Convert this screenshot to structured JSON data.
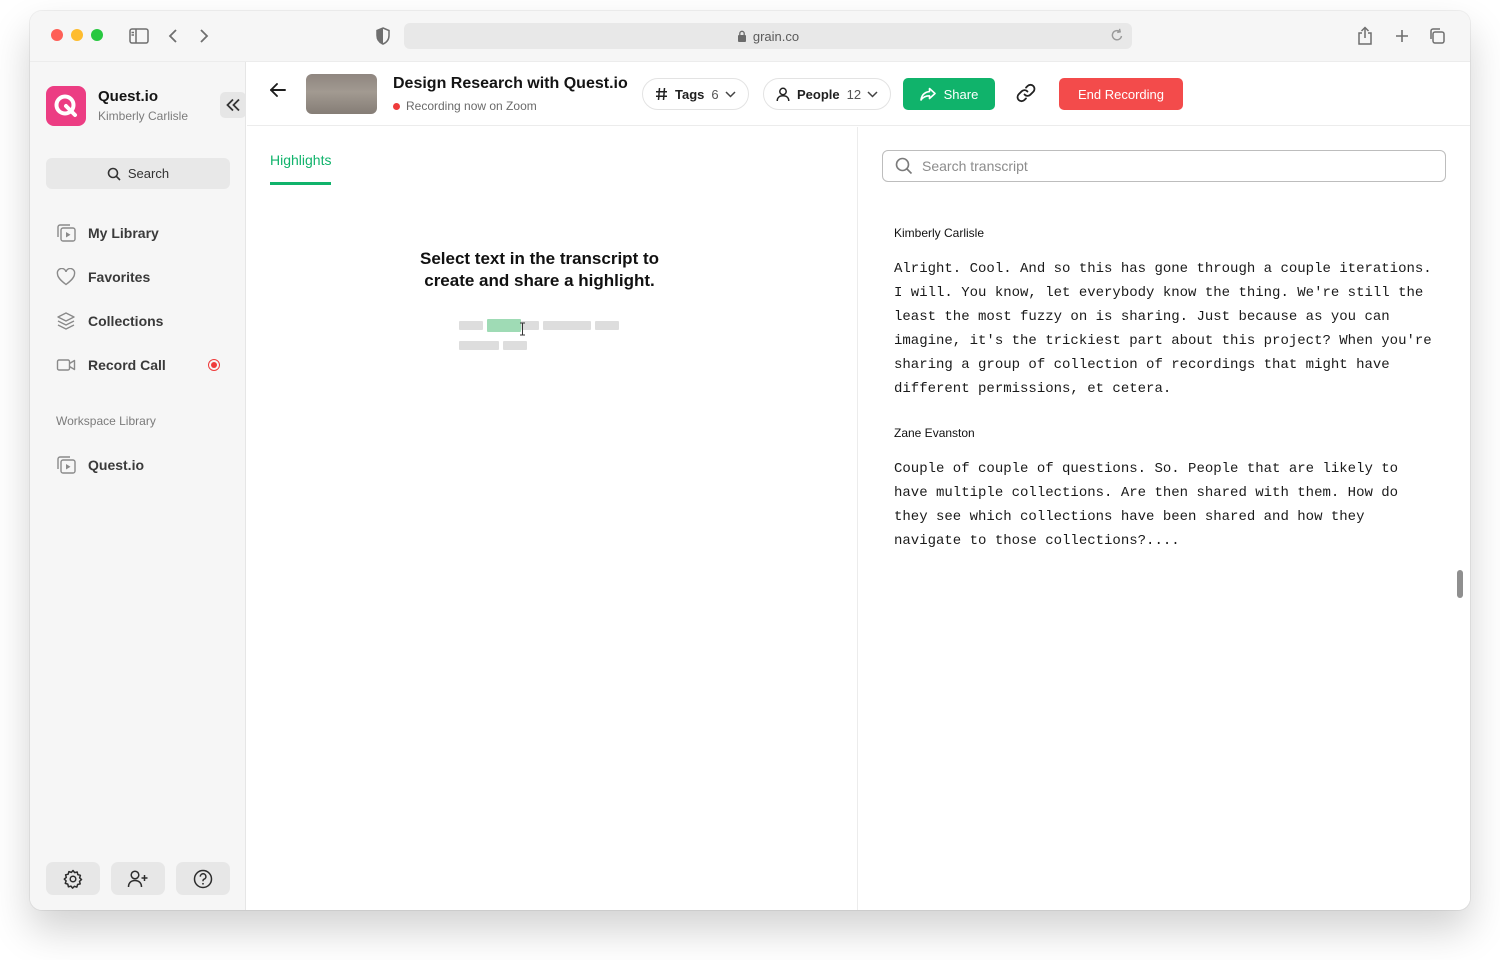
{
  "browser": {
    "url": "grain.co"
  },
  "sidebar": {
    "workspace_name": "Quest.io",
    "user_name": "Kimberly Carlisle",
    "search_label": "Search",
    "items": [
      {
        "label": "My Library",
        "icon": "library-icon"
      },
      {
        "label": "Favorites",
        "icon": "heart-icon"
      },
      {
        "label": "Collections",
        "icon": "layers-icon"
      },
      {
        "label": "Record Call",
        "icon": "video-icon",
        "recording": true
      }
    ],
    "section_label": "Workspace Library",
    "workspace_items": [
      {
        "label": "Quest.io",
        "icon": "library-icon"
      }
    ],
    "footer_buttons": [
      "settings-icon",
      "add-user-icon",
      "help-icon"
    ]
  },
  "header": {
    "title": "Design Research with Quest.io",
    "status": "Recording now on Zoom",
    "tags_label": "Tags",
    "tags_count": "6",
    "people_label": "People",
    "people_count": "12",
    "share_label": "Share",
    "end_label": "End Recording"
  },
  "highlights": {
    "tab_label": "Highlights",
    "empty_line1": "Select text in the transcript to",
    "empty_line2": "create and share a highlight."
  },
  "transcript": {
    "search_placeholder": "Search transcript",
    "entries": [
      {
        "speaker": "Kimberly Carlisle",
        "lines": [
          "Alright. Cool. And so this has gone through a couple iterations.",
          "I will. You know, let everybody know the thing. We're still the",
          "least the most fuzzy on is sharing. Just because as you can",
          "imagine, it's the trickiest part about this project? When you're",
          "sharing a group of collection of recordings that might have",
          "different permissions, et cetera."
        ]
      },
      {
        "speaker": "Zane Evanston",
        "lines": [
          "Couple of couple of questions. So. People that are likely to",
          "have multiple collections. Are then shared with them. How do",
          "they see which collections have been shared and how they",
          "navigate to those collections?...."
        ]
      }
    ]
  },
  "colors": {
    "accent_green": "#10b36b",
    "danger_red": "#f34b4b",
    "brand_pink": "#ec3d83"
  }
}
